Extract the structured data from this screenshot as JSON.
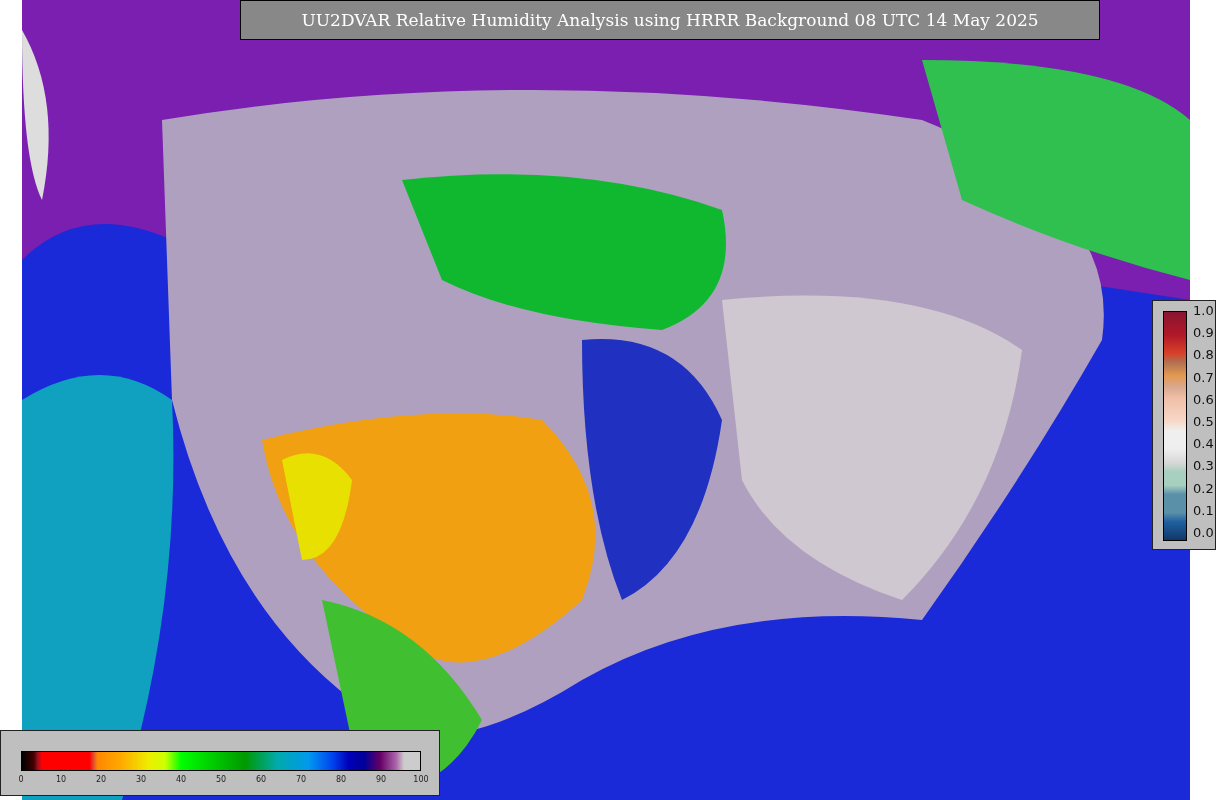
{
  "title": "UU2DVAR Relative Humidity Analysis using HRRR Background 08 UTC 14 May 2025",
  "humidity_scale": {
    "ticks": [
      "0",
      "10",
      "20",
      "30",
      "40",
      "50",
      "60",
      "70",
      "80",
      "90",
      "100"
    ]
  },
  "ratio_scale": {
    "ticks": [
      "1.0",
      "0.9",
      "0.8",
      "0.7",
      "0.6",
      "0.5",
      "0.4",
      "0.3",
      "0.2",
      "0.1",
      "0.0"
    ]
  }
}
